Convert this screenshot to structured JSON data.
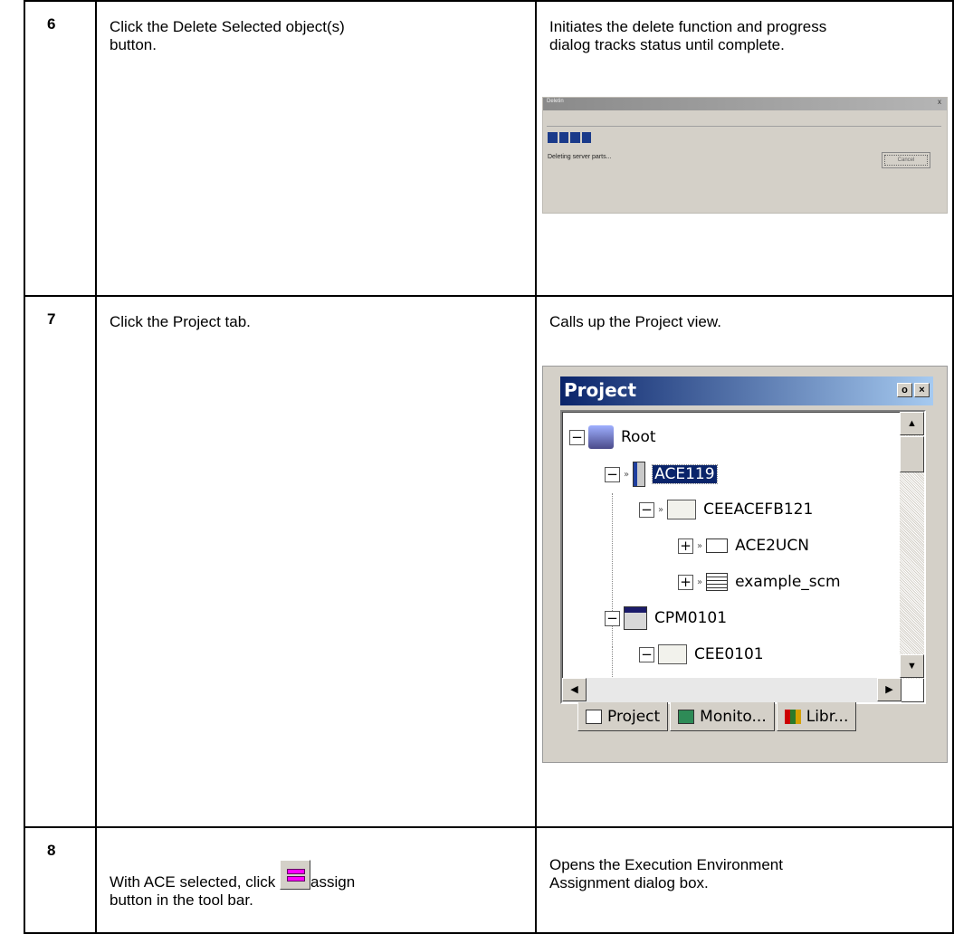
{
  "rows": [
    {
      "step": "6",
      "action_lines": [
        "Click the Delete Selected object(s)",
        "button."
      ],
      "result_lines": [
        "Initiates the delete function and progress",
        "dialog tracks status until complete."
      ]
    },
    {
      "step": "7",
      "action_lines": [
        "Click the Project tab."
      ],
      "result_lines": [
        "Calls up the Project view."
      ]
    },
    {
      "step": "8",
      "action_before": "With ACE selected, click ",
      "action_after": "assign",
      "action_line2": "button in the tool bar.",
      "result_lines": [
        "Opens the Execution Environment",
        "Assignment dialog box."
      ]
    }
  ],
  "delete_dialog": {
    "title": "Deletin",
    "close_glyph": "x",
    "status_text": "Deleting server parts...",
    "cancel_label": "Cancel",
    "progress_segments": 4
  },
  "project_pane": {
    "title": "Project",
    "pin_glyph": "o",
    "close_glyph": "×",
    "tree": [
      {
        "label": "Root",
        "icon": "computer-icon",
        "expander": "−"
      },
      {
        "label": "ACE119",
        "icon": "ace-node-icon",
        "expander": "−",
        "selected": true
      },
      {
        "label": "CEEACEFB121",
        "icon": "folder-icon",
        "expander": "−"
      },
      {
        "label": "ACE2UCN",
        "icon": "control-module-icon",
        "expander": "+"
      },
      {
        "label": "example_scm",
        "icon": "sequence-module-icon",
        "expander": "+"
      },
      {
        "label": "CPM0101",
        "icon": "cpm-icon",
        "expander": "−"
      },
      {
        "label": "CEE0101",
        "icon": "folder-icon",
        "expander": "−"
      }
    ],
    "tabs": [
      {
        "label": "Project",
        "icon": "project-tab-icon"
      },
      {
        "label": "Monito...",
        "icon": "monitor-tab-icon"
      },
      {
        "label": "Libr...",
        "icon": "library-tab-icon"
      }
    ]
  }
}
